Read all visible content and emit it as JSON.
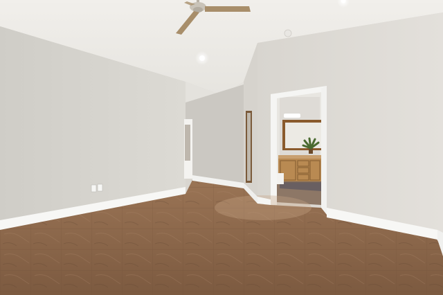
{
  "scene": {
    "type": "photograph",
    "colors": {
      "ceiling": "#eeece8",
      "left_wall": "#d5d3ce",
      "right_wall": "#dedbd5",
      "corridor_wall": "#cfccc6",
      "baseboard": "#f7f7f5",
      "floor": "#8a6448",
      "floor_dark": "#6e4e38",
      "floor_light": "#a07a5c",
      "cabinet": "#b98a52",
      "mirror_frame": "#8a5a2c",
      "mirror_glass": "#eceae4",
      "fan_blade": "#a88e6a",
      "fan_body": "#c9c3b8",
      "plant": "#4a6a30",
      "door_trim": "#f5f5f3",
      "light_glow": "#ffffff"
    },
    "icons": {
      "ceiling_fan": "ceiling-fan-icon",
      "recessed_light": "recessed-light-icon",
      "outlet": "outlet-icon",
      "plant": "plant-icon"
    }
  }
}
